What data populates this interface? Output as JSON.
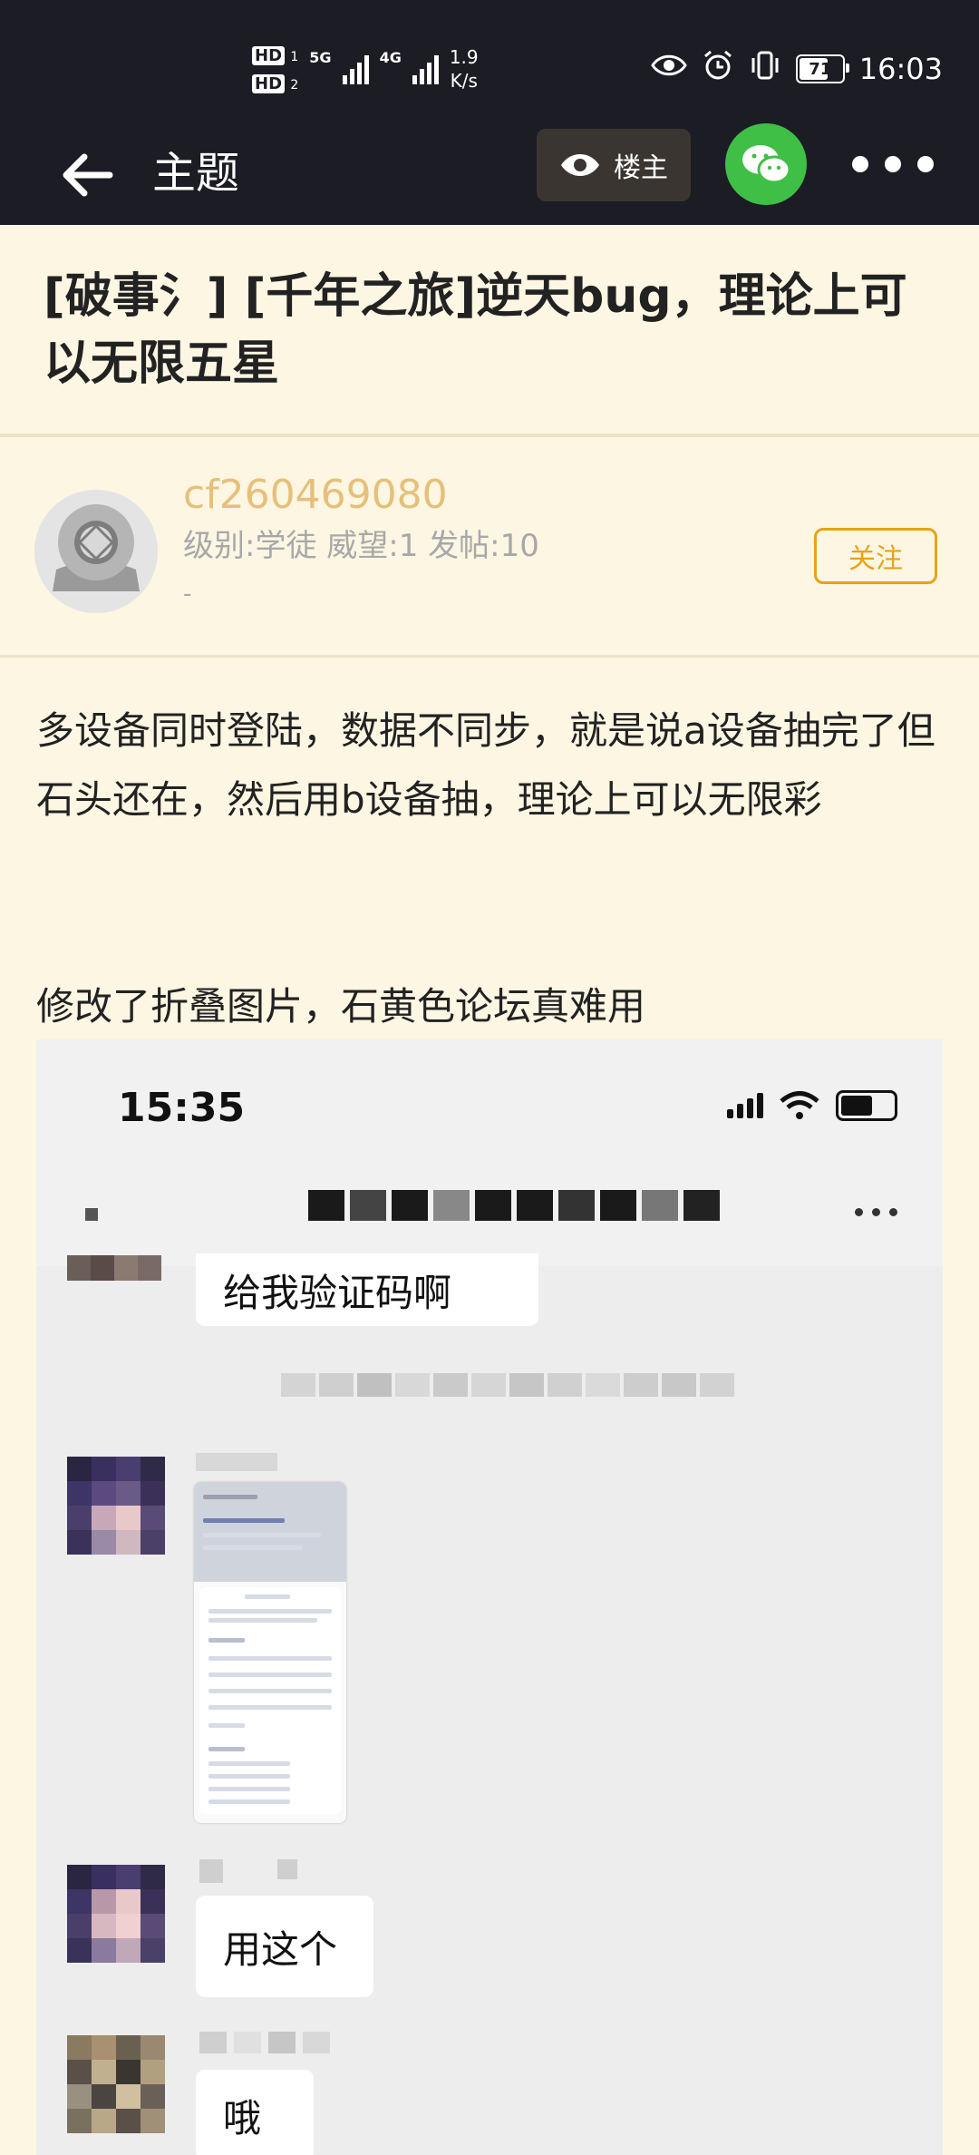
{
  "status_bar": {
    "hd1": "HD",
    "hd1_sub": "1",
    "hd2": "HD",
    "hd2_sub": "2",
    "net1": "5G",
    "net2": "4G",
    "speed_value": "1.9",
    "speed_unit": "K/s",
    "battery": "71",
    "time": "16:03"
  },
  "nav": {
    "title": "主题",
    "op_button": "楼主"
  },
  "post": {
    "title": "[破事氵] [千年之旅]逆天bug，理论上可以无限五星",
    "author": {
      "name": "cf260469080",
      "meta": "级别:学徒 威望:1 发帖:10",
      "signature": "-"
    },
    "follow": "关注",
    "paragraph1": "多设备同时登陆，数据不同步，就是说a设备抽完了但石头还在，然后用b设备抽，理论上可以无限彩",
    "paragraph2": "修改了折叠图片，石黄色论坛真难用"
  },
  "screenshot": {
    "time": "15:35",
    "msg1": "给我验证码啊",
    "msg2": "用这个",
    "msg3": "哦"
  },
  "colors": {
    "topbar": "#1c1c24",
    "page_bg": "#fdf6e3",
    "author_name": "#e6c07a",
    "follow": "#e8a317",
    "wechat": "#3fbf45"
  }
}
